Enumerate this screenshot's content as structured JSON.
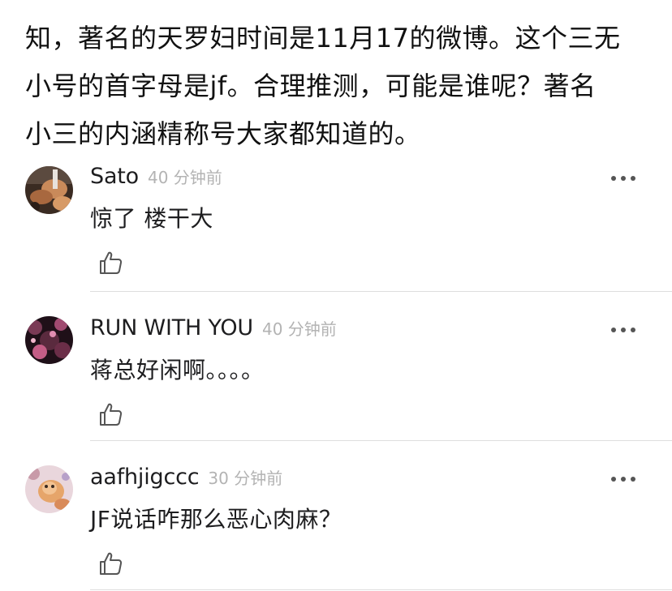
{
  "post": {
    "lines": [
      "知，著名的天罗妇时间是11月17的微博。这个三无",
      "小号的首字母是jf。合理推测，可能是谁呢？著名",
      "小三的内涵精称号大家都知道的。"
    ]
  },
  "comments": [
    {
      "username": "Sato",
      "timestamp": "40 分钟前",
      "text": "惊了 楼干大",
      "avatar_icon": "user-avatar-photo"
    },
    {
      "username": "RUN WITH YOU",
      "timestamp": "40 分钟前",
      "text": "蒋总好闲啊。。。。",
      "avatar_icon": "user-avatar-photo"
    },
    {
      "username": "aafhjigccc",
      "timestamp": "30 分钟前",
      "text": "JF说话咋那么恶心肉麻？",
      "avatar_icon": "user-avatar-photo"
    }
  ],
  "icons": {
    "more": "more-dots-icon",
    "like": "thumbs-up-icon"
  },
  "colors": {
    "text": "#1d1d1f",
    "timestamp": "#b3b3b3",
    "divider": "#dedede",
    "icon": "#555555"
  }
}
